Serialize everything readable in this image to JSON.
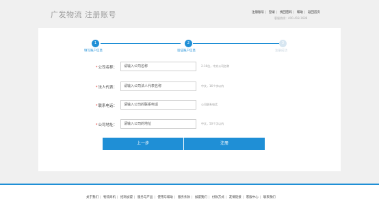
{
  "header": {
    "title": "广发物流 注册账号",
    "nav": [
      "注册账号",
      "登录",
      "找回密码",
      "帮助",
      "返回首页"
    ],
    "hotline": "客服热线：400-418-1688"
  },
  "steps": [
    {
      "num": "1",
      "label": "填写账户信息"
    },
    {
      "num": "2",
      "label": "验证账户信息"
    },
    {
      "num": "3",
      "label": "注册成功"
    }
  ],
  "form": {
    "fields": [
      {
        "label": "公司名称：",
        "placeholder": "请输入公司名称",
        "hint": "2-16位，中文公司名称"
      },
      {
        "label": "法人代表：",
        "placeholder": "请输入公司法人代表名称",
        "hint": "中文，16个字以内"
      },
      {
        "label": "联系电话：",
        "placeholder": "请输入公司的联系电话",
        "hint": "公司联系电话"
      },
      {
        "label": "公司地址：",
        "placeholder": "请输入公司的地址",
        "hint": "中文，50个字以内"
      }
    ],
    "required_mark": "*"
  },
  "buttons": {
    "prev": "上一步",
    "next": "注册"
  },
  "footer": {
    "links": [
      "关于我们",
      "物流商机",
      "招商加盟",
      "服务与产品",
      "使用与帮助",
      "服务条款",
      "加盟我们",
      "付款方式",
      "友情链接",
      "客服中心",
      "联系我们"
    ]
  },
  "colors": {
    "accent": "#1f8fd6",
    "required": "#e0302a",
    "background": "#f0f0f0"
  }
}
